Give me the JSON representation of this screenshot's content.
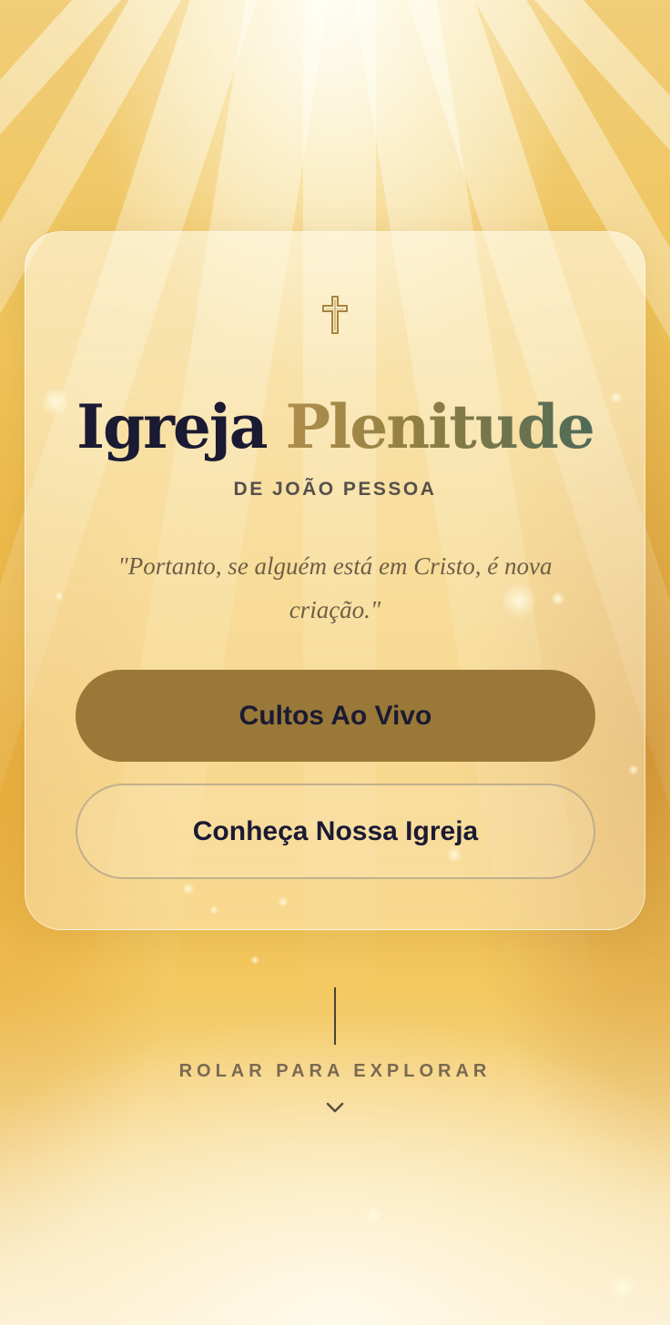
{
  "hero": {
    "cross_icon": "latin-cross-icon",
    "title_part1": "Igreja",
    "title_part2": "Plenitude",
    "subtitle": "DE JOÃO PESSOA",
    "verse": "\"Portanto, se alguém está em Cristo, é nova criação.\""
  },
  "actions": {
    "primary_label": "Cultos Ao Vivo",
    "secondary_label": "Conheça Nossa Igreja"
  },
  "scroll": {
    "label": "ROLAR PARA EXPLORAR",
    "icon": "chevron-down-icon"
  },
  "colors": {
    "navy_text": "#1b1a33",
    "gold_accent": "#9a7837",
    "gold_title": "#b08e4c",
    "teal_title": "#4e6a5a",
    "background_gold": "#f0bf4c"
  }
}
